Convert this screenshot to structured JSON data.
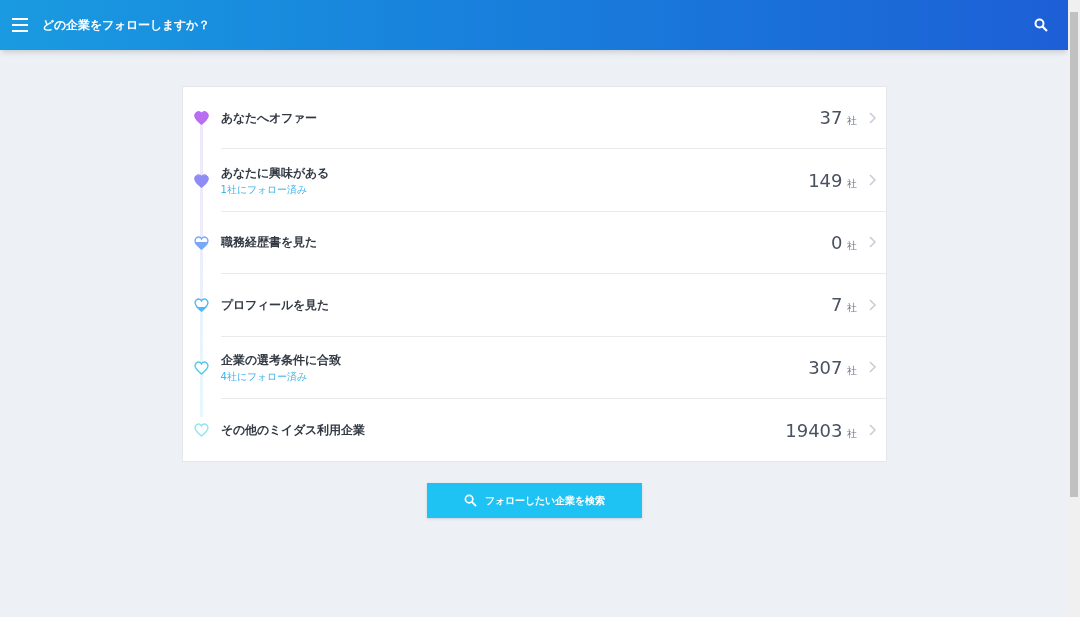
{
  "header": {
    "title": "どの企業をフォローしますか？"
  },
  "stages": [
    {
      "label": "あなたへオファー",
      "count": "37",
      "unit": "社",
      "color": "#b86ef0",
      "kind": "full"
    },
    {
      "label": "あなたに興味がある",
      "note": "1社にフォロー済み",
      "count": "149",
      "unit": "社",
      "color": "#8f8cf5",
      "kind": "mostly"
    },
    {
      "label": "職務経歴書を見た",
      "count": "0",
      "unit": "社",
      "color": "#7aa8f5",
      "kind": "half"
    },
    {
      "label": "プロフィールを見た",
      "count": "7",
      "unit": "社",
      "color": "#55b6f5",
      "kind": "low"
    },
    {
      "label": "企業の選考条件に合致",
      "note": "4社にフォロー済み",
      "count": "307",
      "unit": "社",
      "color": "#4cc9ea",
      "kind": "outline"
    },
    {
      "label": "その他のミイダス利用企業",
      "count": "19403",
      "unit": "社",
      "color": "#8fe3f0",
      "kind": "outline"
    }
  ],
  "search_button": {
    "label": "フォローしたい企業を検索"
  }
}
